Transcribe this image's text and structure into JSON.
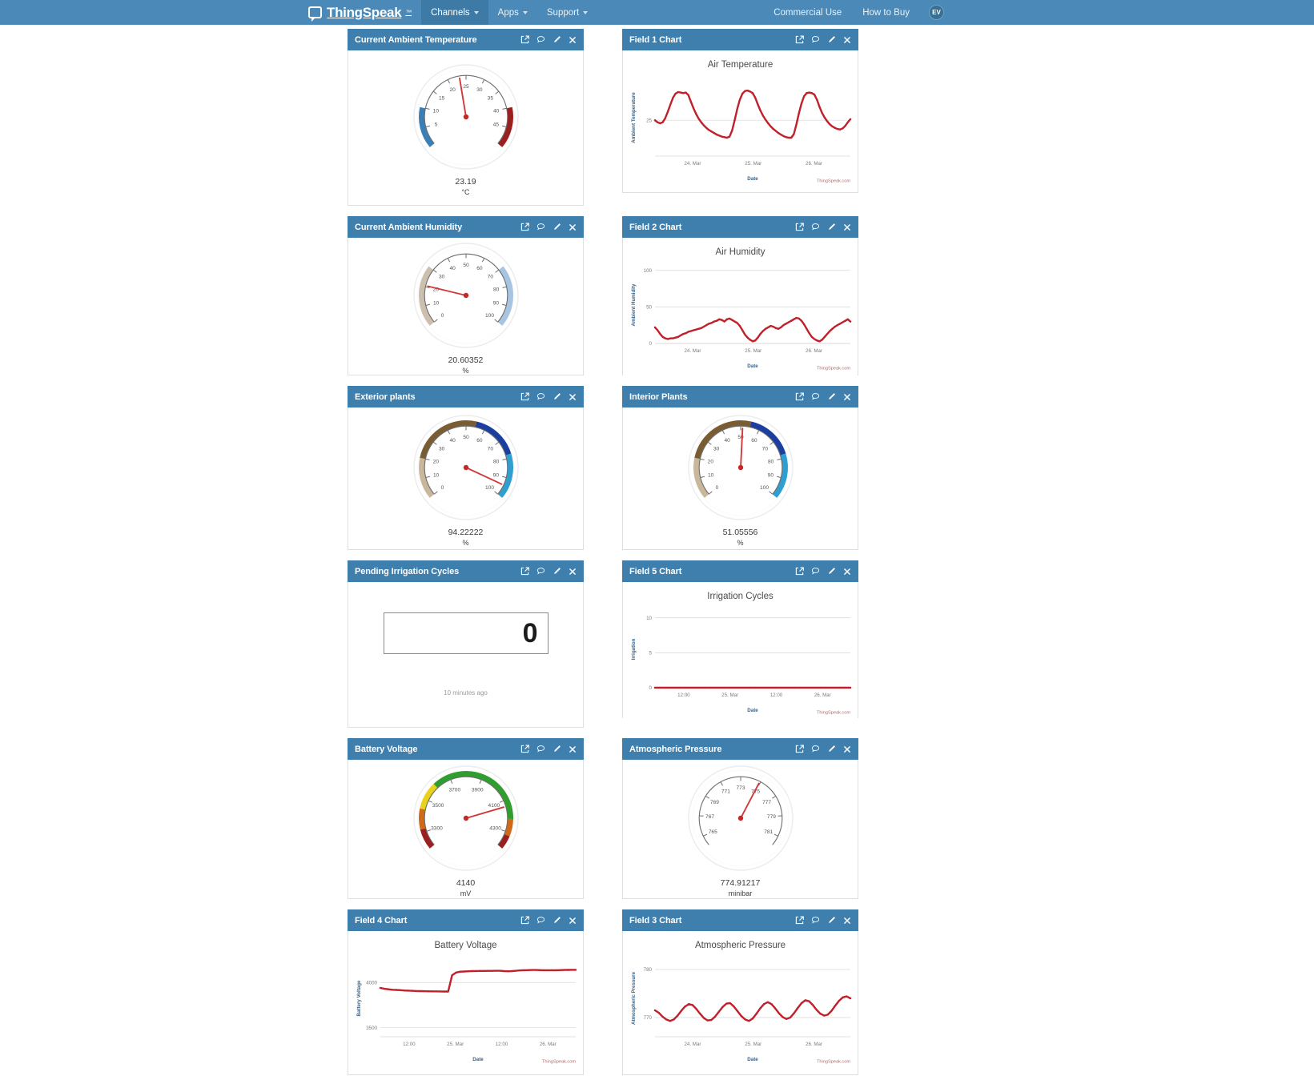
{
  "navbar": {
    "brand": "ThingSpeak",
    "brand_tm": "™",
    "items": [
      {
        "label": "Channels",
        "caret": true,
        "active": true
      },
      {
        "label": "Apps",
        "caret": true,
        "active": false
      },
      {
        "label": "Support",
        "caret": true,
        "active": false
      }
    ],
    "right_items": [
      {
        "label": "Commercial Use"
      },
      {
        "label": "How to Buy"
      }
    ],
    "avatar_initials": "EV",
    "brand_icon": "speech-bubble-logo-icon"
  },
  "widget_icons": {
    "popout": "external-link-icon",
    "comment": "comment-icon",
    "edit": "pencil-icon",
    "close": "close-icon"
  },
  "widgets": [
    {
      "id": "current-ambient-temperature",
      "title": "Current Ambient Temperature",
      "type": "gauge",
      "gauge": {
        "min": 0,
        "max": 50,
        "value": 23.19,
        "value_label": "23.19",
        "unit": "°C",
        "ticks": [
          5,
          10,
          15,
          20,
          25,
          30,
          35,
          40,
          45
        ],
        "bands": [
          {
            "from": 0,
            "to": 10,
            "color": "#3a7fb5"
          },
          {
            "from": 40,
            "to": 50,
            "color": "#9b1f1f"
          }
        ]
      }
    },
    {
      "id": "field-1-chart",
      "title": "Field 1 Chart",
      "type": "chart",
      "chart_data": {
        "type": "line",
        "title": "Air Temperature",
        "xlabel": "Date",
        "ylabel": "Ambient Temperature",
        "ylim": [
          18,
          33
        ],
        "yticks": [
          25
        ],
        "xticks": [
          "24. Mar",
          "25. Mar",
          "26. Mar"
        ],
        "series": [
          {
            "name": "Ambient Temperature",
            "color": "#c0202b",
            "values": [
              25.0,
              24.6,
              24.4,
              24.6,
              25.4,
              26.7,
              28.1,
              29.4,
              30.2,
              30.5,
              30.4,
              30.3,
              30.4,
              29.9,
              28.6,
              27.3,
              26.2,
              25.3,
              24.6,
              24.0,
              23.5,
              23.1,
              22.8,
              22.5,
              22.2,
              22.0,
              21.8,
              21.7,
              21.6,
              21.8,
              23.0,
              25.0,
              27.2,
              29.0,
              30.2,
              30.7,
              30.8,
              30.6,
              30.3,
              29.4,
              28.1,
              26.9,
              25.9,
              25.1,
              24.4,
              23.8,
              23.3,
              22.9,
              22.5,
              22.2,
              21.9,
              21.7,
              21.6,
              21.6,
              22.3,
              24.2,
              26.4,
              28.3,
              29.7,
              30.3,
              30.4,
              30.3,
              30.0,
              29.0,
              27.6,
              26.4,
              25.5,
              24.8,
              24.2,
              23.8,
              23.5,
              23.3,
              23.2,
              23.4,
              23.9,
              24.6,
              25.2
            ]
          }
        ],
        "watermark": "ThingSpeak.com"
      }
    },
    {
      "id": "current-ambient-humidity",
      "title": "Current Ambient Humidity",
      "type": "gauge",
      "gauge": {
        "min": 0,
        "max": 100,
        "value": 20.60352,
        "value_label": "20.60352",
        "unit": "%",
        "ticks": [
          0,
          10,
          20,
          30,
          40,
          50,
          60,
          70,
          80,
          90,
          100
        ],
        "bands": [
          {
            "from": 0,
            "to": 30,
            "color": "#cdbfae"
          },
          {
            "from": 70,
            "to": 100,
            "color": "#a7c4e0"
          }
        ]
      }
    },
    {
      "id": "field-2-chart",
      "title": "Field 2 Chart",
      "type": "chart",
      "chart_data": {
        "type": "line",
        "title": "Air Humidity",
        "xlabel": "Date",
        "ylabel": "Ambient Humidity",
        "ylim": [
          0,
          105
        ],
        "yticks": [
          0,
          50,
          100
        ],
        "xticks": [
          "24. Mar",
          "25. Mar",
          "26. Mar"
        ],
        "series": [
          {
            "name": "Ambient Humidity",
            "color": "#c0202b",
            "values": [
              22,
              18,
              13,
              9,
              7,
              6,
              7,
              7,
              8,
              9,
              11,
              13,
              14,
              16,
              17,
              18,
              19,
              20,
              21,
              23,
              25,
              27,
              28,
              30,
              31,
              33,
              32,
              30,
              33,
              34,
              32,
              30,
              28,
              24,
              18,
              12,
              8,
              5,
              3,
              4,
              8,
              13,
              17,
              20,
              22,
              24,
              23,
              21,
              20,
              22,
              25,
              27,
              29,
              31,
              33,
              35,
              34,
              31,
              26,
              20,
              14,
              9,
              6,
              4,
              3,
              5,
              9,
              13,
              17,
              20,
              23,
              25,
              27,
              29,
              31,
              33,
              30
            ]
          }
        ],
        "watermark": "ThingSpeak.com"
      }
    },
    {
      "id": "exterior-plants",
      "title": "Exterior plants",
      "type": "gauge",
      "gauge": {
        "min": 0,
        "max": 100,
        "value": 94.22222,
        "value_label": "94.22222",
        "unit": "%",
        "ticks": [
          0,
          10,
          20,
          30,
          40,
          50,
          60,
          70,
          80,
          90,
          100
        ],
        "bands": [
          {
            "from": 0,
            "to": 20,
            "color": "#c9b79c"
          },
          {
            "from": 20,
            "to": 55,
            "color": "#7a5c33"
          },
          {
            "from": 55,
            "to": 78,
            "color": "#1a3fa0"
          },
          {
            "from": 78,
            "to": 100,
            "color": "#2f9fd0"
          }
        ]
      }
    },
    {
      "id": "interior-plants",
      "title": "Interior Plants",
      "type": "gauge",
      "gauge": {
        "min": 0,
        "max": 100,
        "value": 51.05556,
        "value_label": "51.05556",
        "unit": "%",
        "ticks": [
          0,
          10,
          20,
          30,
          40,
          50,
          60,
          70,
          80,
          90,
          100
        ],
        "bands": [
          {
            "from": 0,
            "to": 20,
            "color": "#c9b79c"
          },
          {
            "from": 20,
            "to": 55,
            "color": "#7a5c33"
          },
          {
            "from": 55,
            "to": 78,
            "color": "#1a3fa0"
          },
          {
            "from": 78,
            "to": 100,
            "color": "#2f9fd0"
          }
        ]
      }
    },
    {
      "id": "pending-irrigation-cycles",
      "title": "Pending Irrigation Cycles",
      "type": "numeric",
      "numeric": {
        "value": "0",
        "timestamp": "10 minutes ago"
      }
    },
    {
      "id": "field-5-chart",
      "title": "Field 5 Chart",
      "type": "chart",
      "chart_data": {
        "type": "line",
        "title": "Irrigation Cycles",
        "xlabel": "Date",
        "ylabel": "Irrigation",
        "ylim": [
          0,
          11
        ],
        "yticks": [
          0,
          5,
          10
        ],
        "xticks": [
          "12:00",
          "25. Mar",
          "12:00",
          "26. Mar"
        ],
        "series": [
          {
            "name": "Irrigation",
            "color": "#c0202b",
            "values": [
              0,
              0,
              0,
              0,
              0,
              0,
              0,
              0,
              0,
              0,
              0,
              0,
              0,
              0,
              0,
              0,
              0,
              0,
              0,
              0,
              0,
              0,
              0,
              0,
              0,
              0,
              0,
              0,
              0,
              0,
              0,
              0,
              0,
              0,
              0,
              0,
              0,
              0,
              0,
              0
            ]
          }
        ],
        "watermark": "ThingSpeak.com"
      }
    },
    {
      "id": "battery-voltage-gauge",
      "title": "Battery Voltage",
      "type": "gauge",
      "gauge": {
        "min": 3200,
        "max": 4400,
        "value": 4140,
        "value_label": "4140",
        "unit": "mV",
        "ticks": [
          3300,
          3500,
          3700,
          3900,
          4100,
          4300
        ],
        "bands": [
          {
            "from": 3200,
            "to": 3320,
            "color": "#9b1f1f"
          },
          {
            "from": 3320,
            "to": 3440,
            "color": "#cf6a18"
          },
          {
            "from": 3440,
            "to": 3600,
            "color": "#e8d21a"
          },
          {
            "from": 3600,
            "to": 4220,
            "color": "#2f9e2f"
          },
          {
            "from": 4220,
            "to": 4320,
            "color": "#cf6a18"
          },
          {
            "from": 4320,
            "to": 4400,
            "color": "#9b1f1f"
          }
        ]
      }
    },
    {
      "id": "atmospheric-pressure-gauge",
      "title": "Atmospheric Pressure",
      "type": "gauge",
      "gauge": {
        "min": 764,
        "max": 782,
        "value": 774.91217,
        "value_label": "774.91217",
        "unit": "minibar",
        "ticks": [
          765,
          767,
          769,
          771,
          773,
          775,
          777,
          779,
          781
        ],
        "bands": []
      }
    },
    {
      "id": "field-4-chart",
      "title": "Field 4 Chart",
      "type": "chart",
      "chart_data": {
        "type": "line",
        "title": "Battery Voltage",
        "xlabel": "Date",
        "ylabel": "Battery Voltage",
        "ylim": [
          3400,
          4250
        ],
        "yticks": [
          3500,
          4000
        ],
        "xticks": [
          "12:00",
          "25. Mar",
          "12:00",
          "26. Mar"
        ],
        "series": [
          {
            "name": "Battery Voltage",
            "color": "#c0202b",
            "values": [
              3940,
              3930,
              3925,
              3920,
              3918,
              3915,
              3912,
              3910,
              3908,
              3906,
              3905,
              3904,
              3903,
              3902,
              3902,
              3901,
              3900,
              3900,
              4080,
              4110,
              4120,
              4122,
              4124,
              4126,
              4127,
              4128,
              4128,
              4129,
              4129,
              4130,
              4130,
              4126,
              4124,
              4126,
              4130,
              4134,
              4136,
              4137,
              4138,
              4138,
              4137,
              4136,
              4136,
              4136,
              4136,
              4137,
              4138,
              4139,
              4140,
              4140
            ]
          }
        ],
        "watermark": "ThingSpeak.com"
      }
    },
    {
      "id": "field-3-chart",
      "title": "Field 3 Chart",
      "type": "chart",
      "chart_data": {
        "type": "line",
        "title": "Atmospheric Pressure",
        "xlabel": "Date",
        "ylabel": "Atmospheric Pressure",
        "ylim": [
          766,
          782
        ],
        "yticks": [
          770,
          780
        ],
        "xticks": [
          "24. Mar",
          "25. Mar",
          "26. Mar"
        ],
        "series": [
          {
            "name": "Atmospheric Pressure",
            "color": "#c0202b",
            "values": [
              771.5,
              771.0,
              770.2,
              769.6,
              769.3,
              769.6,
              770.4,
              771.4,
              772.3,
              772.8,
              772.6,
              771.8,
              770.8,
              769.9,
              769.4,
              769.5,
              770.2,
              771.2,
              772.2,
              772.9,
              773.0,
              772.3,
              771.3,
              770.3,
              769.6,
              769.3,
              769.8,
              770.8,
              771.9,
              772.8,
              773.2,
              772.8,
              771.9,
              770.9,
              770.1,
              769.7,
              770.0,
              770.9,
              772.0,
              773.0,
              773.6,
              773.4,
              772.6,
              771.6,
              770.8,
              770.4,
              770.6,
              771.4,
              772.5,
              773.5,
              774.2,
              774.4,
              774.0
            ]
          }
        ],
        "watermark": "ThingSpeak.com"
      }
    }
  ]
}
